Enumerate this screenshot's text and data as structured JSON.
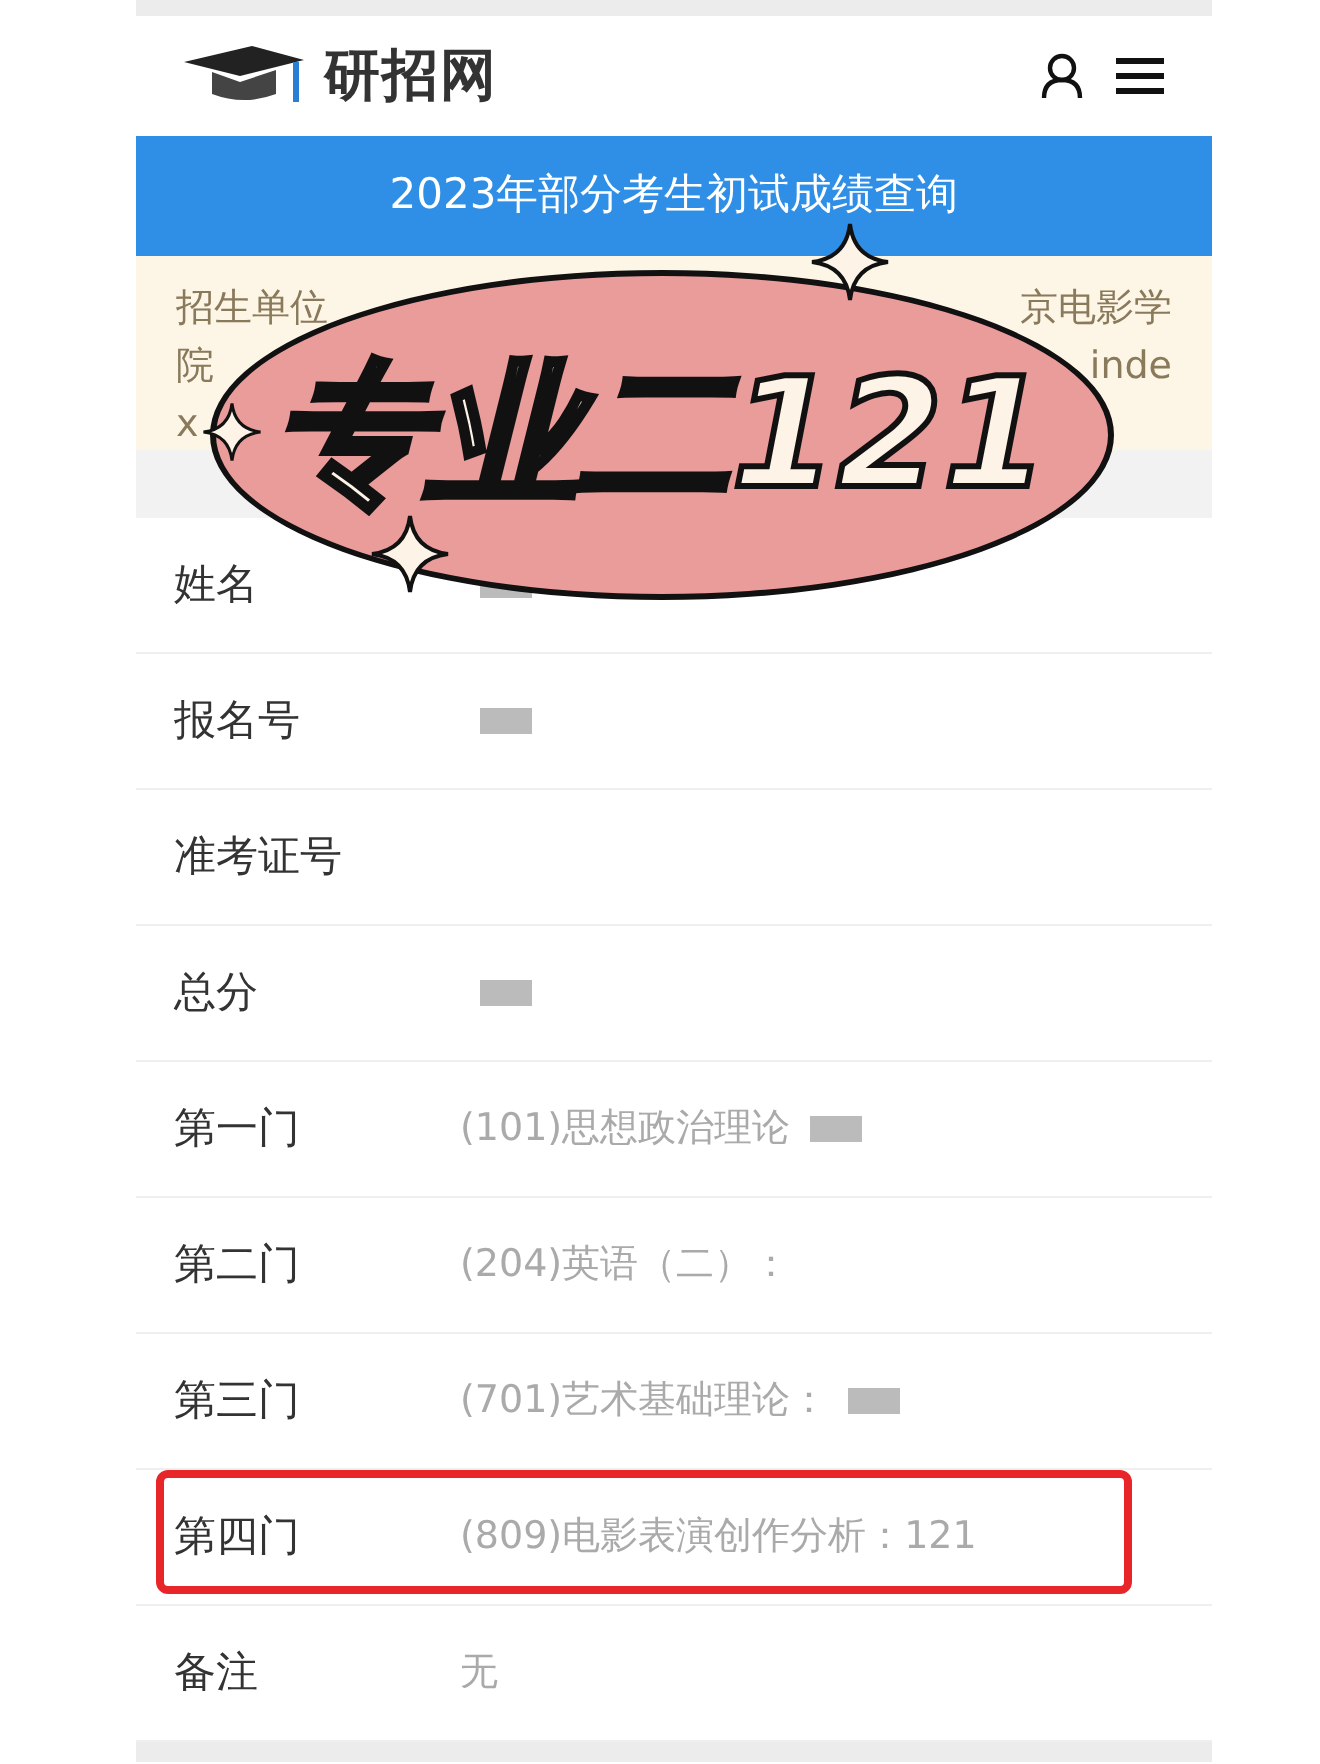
{
  "header": {
    "logo_text": "研招网"
  },
  "title_bar": {
    "title": "2023年部分考生初试成绩查询"
  },
  "notice": {
    "lines": [
      {
        "left": "招生单位",
        "right": "京电影学"
      },
      {
        "left": "院",
        "right": "inde"
      },
      {
        "left": "x"
      }
    ]
  },
  "rows": [
    {
      "label": "姓名",
      "redacted": true,
      "highlighted": false
    },
    {
      "label": "报名号",
      "redacted": true,
      "highlighted": false
    },
    {
      "label": "准考证号",
      "redacted": false,
      "highlighted": false
    },
    {
      "label": "总分",
      "redacted": true,
      "highlighted": false
    },
    {
      "label": "第一门",
      "value": "(101)思想政治理论",
      "redacted": true,
      "highlighted": false
    },
    {
      "label": "第二门",
      "value": "(204)英语（二）：",
      "redacted": false,
      "highlighted": false
    },
    {
      "label": "第三门",
      "value": "(701)艺术基础理论：",
      "redacted": true,
      "highlighted": false
    },
    {
      "label": "第四门",
      "value": "(809)电影表演创作分析：121",
      "redacted": false,
      "highlighted": true
    },
    {
      "label": "备注",
      "value": "无",
      "redacted": false,
      "highlighted": false
    }
  ],
  "sticker": {
    "text": "专业二121"
  }
}
